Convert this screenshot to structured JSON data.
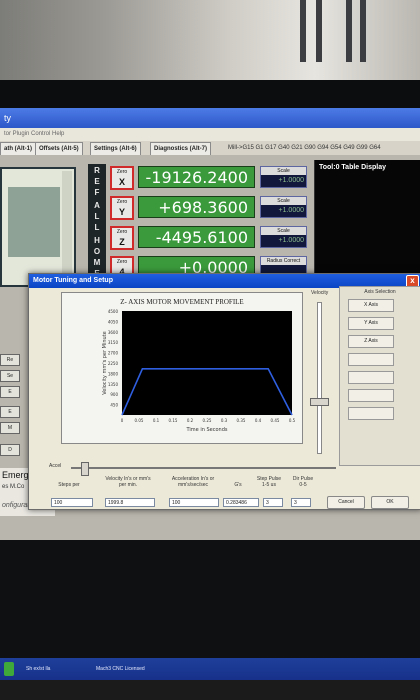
{
  "window": {
    "title": "ty",
    "menu": "tor  Plugin Control  Help"
  },
  "tabs": [
    "ath (Alt-1)",
    "Offsets (Alt-5)",
    "Settings (Alt-6)",
    "Diagnostics (Alt-7)"
  ],
  "gcode_status": "Mill->G15  G1 G17 G40 G21 G90 G94 G54 G49 G99 G64",
  "reference_letters": [
    "R",
    "E",
    "F",
    "A",
    "L",
    "L",
    "H",
    "O",
    "M",
    "E"
  ],
  "axes": [
    {
      "zero_label": "Zero",
      "axis": "X",
      "value": "-19126.2400",
      "scale_label": "Scale",
      "scale_value": "+1.0000"
    },
    {
      "zero_label": "Zero",
      "axis": "Y",
      "value": "+698.3600",
      "scale_label": "Scale",
      "scale_value": "+1.0000"
    },
    {
      "zero_label": "Zero",
      "axis": "Z",
      "value": "-4495.6100",
      "scale_label": "Scale",
      "scale_value": "+1.0000"
    },
    {
      "zero_label": "Zero",
      "axis": "4",
      "value": "+0.0000",
      "scale_label": "Radius Correct",
      "scale_value": ""
    }
  ],
  "tool_panel_title": "Tool:0  Table Display",
  "emergency": {
    "label": "Emerger",
    "sub": "es   M.Co",
    "config": "onfiguratio"
  },
  "side_labels": [
    "Re",
    "Se",
    "E",
    "E",
    "M",
    "D"
  ],
  "dialog": {
    "title": "Motor Tuning and Setup",
    "close": "x",
    "velocity_label": "Velocity",
    "axis_selection_label": "Axis Selection",
    "axis_buttons": [
      "X Axis",
      "Y Axis",
      "Z Axis",
      "",
      "",
      "",
      ""
    ],
    "accel_label": "Accel",
    "fields": [
      {
        "label": "Steps per",
        "value": "100"
      },
      {
        "label": "Velocity In's or mm's per min.",
        "value": "1999.8"
      },
      {
        "label": "Acceleration In's or mm's/sec/sec",
        "value": "100"
      },
      {
        "label": "G's",
        "value": "0.283486"
      },
      {
        "label": "Step Pulse 1-5 us",
        "value": "3"
      },
      {
        "label": "Dir Pulse 0-5",
        "value": "3"
      }
    ],
    "cancel": "Cancel",
    "ok": "OK"
  },
  "chart_data": {
    "type": "line",
    "title": "Z- AXIS MOTOR MOVEMENT PROFILE",
    "xlabel": "Time in Seconds",
    "ylabel": "Velocity mm's per Minute",
    "x_ticks": [
      "0",
      "0.05",
      "0.1",
      "0.15",
      "0.2",
      "0.25",
      "0.3",
      "0.35",
      "0.4",
      "0.45",
      "0.5"
    ],
    "y_ticks": [
      "450",
      "900",
      "1350",
      "1800",
      "2250",
      "2700",
      "3150",
      "3600",
      "4050",
      "4500"
    ],
    "xlim": [
      0,
      0.5
    ],
    "ylim": [
      0,
      4500
    ],
    "series": [
      {
        "x": [
          0,
          0.06,
          0.43,
          0.5
        ],
        "y": [
          0,
          1999.8,
          1999.8,
          0
        ],
        "color": "#2f5fe0"
      }
    ],
    "grid": false
  },
  "taskbar": {
    "items": [
      "Sh ex/st lla",
      "Mach3 CNC  Licensed"
    ]
  },
  "colors": {
    "dro_green": "#3b9a3c",
    "dialog_title": "#0a44c4",
    "profile_line": "#2f5fe0"
  }
}
